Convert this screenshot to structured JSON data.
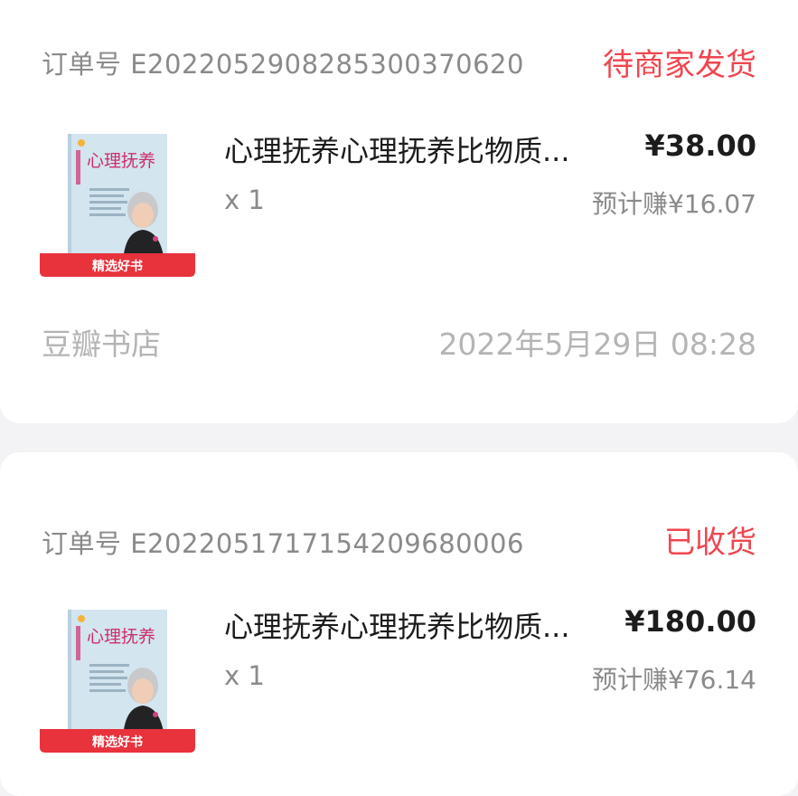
{
  "colors": {
    "page_bg": "#f3f3f5",
    "card_bg": "#ffffff",
    "status_red": "#f0454e",
    "tag_red": "#e8323c",
    "cover_blue": "#d3e5ef"
  },
  "orders": [
    {
      "order_no": "订单号 E2022052908285300370620",
      "status": "待商家发货",
      "cover": {
        "title": "心理抚养",
        "tag": "精选好书",
        "icon": "book-cover-icon"
      },
      "item_title": "心理抚养心理抚养比物质...",
      "price": "¥38.00",
      "qty": "x 1",
      "earn": "预计赚¥16.07",
      "shop": "豆瓣书店",
      "time": "2022年5月29日 08:28"
    },
    {
      "order_no": "订单号 E2022051717154209680006",
      "status": "已收货",
      "cover": {
        "title": "心理抚养",
        "tag": "精选好书",
        "icon": "book-cover-icon"
      },
      "item_title": "心理抚养心理抚养比物质...",
      "price": "¥180.00",
      "qty": "x 1",
      "earn": "预计赚¥76.14"
    }
  ]
}
